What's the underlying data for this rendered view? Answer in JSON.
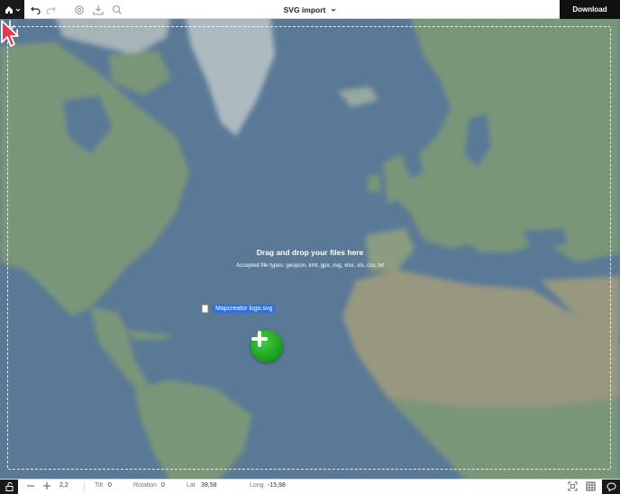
{
  "header": {
    "title": "SVG import",
    "download_label": "Download",
    "icons": [
      "home-icon",
      "chevron-down-icon",
      "undo-icon",
      "redo-icon",
      "settings-icon",
      "import-icon",
      "search-icon"
    ]
  },
  "dropzone": {
    "title": "Drag and drop your files here",
    "subtitle": "Accepted file types: geojson, kml, gpx, svg, xlsx, xls, csv, txt",
    "dragged_file": "Mapcreator logo.svg"
  },
  "status": {
    "zoom": "2,2",
    "tilt_label": "Tilt",
    "tilt_value": "0",
    "rotation_label": "Rotation",
    "rotation_value": "0",
    "lat_label": "Lat",
    "lat_value": "39,58",
    "long_label": "Long",
    "long_value": "-15,98"
  },
  "colors": {
    "ocean": "#5f7f9c",
    "land": "#8fa872",
    "ice": "#d9dcd8",
    "accent_blue": "#2f6fd6",
    "plus_green": "#1a9a1a"
  }
}
